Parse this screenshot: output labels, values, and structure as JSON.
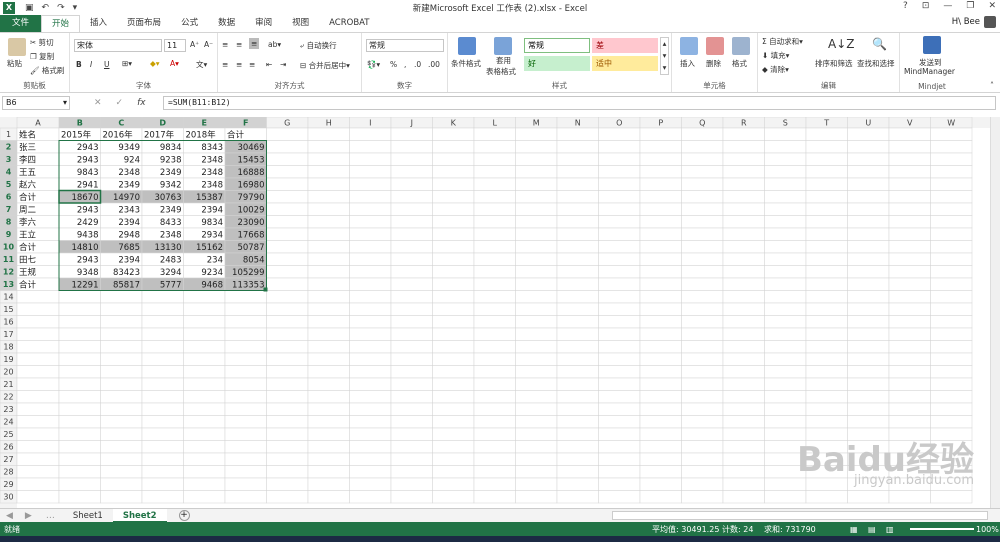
{
  "window": {
    "title": "新建Microsoft Excel 工作表 (2).xlsx - Excel",
    "user": "H\\ Bee",
    "help": "?",
    "controls": [
      "⊡",
      "—",
      "❐",
      "✕"
    ]
  },
  "ribbon_tabs": [
    "文件",
    "开始",
    "插入",
    "页面布局",
    "公式",
    "数据",
    "审阅",
    "视图",
    "ACROBAT"
  ],
  "active_tab": "开始",
  "ribbon": {
    "clipboard": {
      "label": "剪贴板",
      "paste": "粘贴",
      "cut": "剪切",
      "copy": "复制",
      "painter": "格式刷"
    },
    "font": {
      "label": "字体",
      "name": "宋体",
      "size": "11",
      "bold": "B",
      "italic": "I",
      "underline": "U"
    },
    "align": {
      "label": "对齐方式",
      "wrap": "自动换行",
      "merge": "合并后居中"
    },
    "number": {
      "label": "数字",
      "format": "常规",
      "percent": "%"
    },
    "styles": {
      "label": "样式",
      "cond": "条件格式",
      "table1": "套用",
      "table2": "表格格式",
      "cells": [
        {
          "name": "常规",
          "bg": "#ffffff",
          "border": "#7fbf7f",
          "color": "#000000"
        },
        {
          "name": "差",
          "bg": "#ffc7ce",
          "border": "#ffc7ce",
          "color": "#9c0006"
        },
        {
          "name": "好",
          "bg": "#c6efce",
          "border": "#c6efce",
          "color": "#006100"
        },
        {
          "name": "适中",
          "bg": "#ffeb9c",
          "border": "#ffeb9c",
          "color": "#9c5700"
        }
      ]
    },
    "cells": {
      "label": "单元格",
      "insert": "插入",
      "delete": "删除",
      "format": "格式"
    },
    "editing": {
      "label": "编辑",
      "autosum": "自动求和",
      "fill": "填充",
      "clear": "清除",
      "sort": "排序和筛选",
      "find": "查找和选择"
    },
    "mindjet": {
      "label": "Mindjet",
      "send1": "发送到",
      "send2": "MindManager"
    }
  },
  "formula_bar": {
    "namebox": "B6",
    "cancel": "✕",
    "confirm": "✓",
    "fx": "fx",
    "formula": "=SUM(B11:B12)"
  },
  "columns": [
    "A",
    "B",
    "C",
    "D",
    "E",
    "F",
    "G",
    "H",
    "I",
    "J",
    "K",
    "L",
    "M",
    "N",
    "O",
    "P",
    "Q",
    "R",
    "S",
    "T",
    "U",
    "V",
    "W"
  ],
  "rows": [
    [
      "姓名",
      "2015年",
      "2016年",
      "2017年",
      "2018年",
      "合计"
    ],
    [
      "张三",
      "2943",
      "9349",
      "9834",
      "8343",
      "30469"
    ],
    [
      "李四",
      "2943",
      "924",
      "9238",
      "2348",
      "15453"
    ],
    [
      "王五",
      "9843",
      "2348",
      "2349",
      "2348",
      "16888"
    ],
    [
      "赵六",
      "2941",
      "2349",
      "9342",
      "2348",
      "16980"
    ],
    [
      "合计",
      "18670",
      "14970",
      "30763",
      "15387",
      "79790"
    ],
    [
      "周二",
      "2943",
      "2343",
      "2349",
      "2394",
      "10029"
    ],
    [
      "李六",
      "2429",
      "2394",
      "8433",
      "9834",
      "23090"
    ],
    [
      "王立",
      "9438",
      "2948",
      "2348",
      "2934",
      "17668"
    ],
    [
      "合计",
      "14810",
      "7685",
      "13130",
      "15162",
      "50787"
    ],
    [
      "田七",
      "2943",
      "2394",
      "2483",
      "234",
      "8054"
    ],
    [
      "王规",
      "9348",
      "83423",
      "3294",
      "9234",
      "105299"
    ],
    [
      "合计",
      "12291",
      "85817",
      "5777",
      "9468",
      "113353"
    ]
  ],
  "row_count": 30,
  "selection": {
    "active_cell": "B6",
    "selected_columns": [
      "B",
      "C",
      "D",
      "E",
      "F"
    ],
    "selected_rows": [
      2,
      3,
      4,
      5,
      6,
      7,
      8,
      9,
      10,
      11,
      12,
      13
    ]
  },
  "shaded_cells": "#bfbfbf",
  "sheets": [
    "Sheet1",
    "Sheet2"
  ],
  "active_sheet": "Sheet2",
  "add_sheet": "+",
  "status": {
    "ready": "就绪",
    "average": "平均值: 30491.25",
    "count": "计数: 24",
    "sum": "求和: 731790",
    "zoom": "100%"
  },
  "watermark": {
    "brand": "Baidu经验",
    "url": "jingyan.baidu.com"
  },
  "colors": {
    "accent": "#217346",
    "header_selected": "#d2d2d2",
    "grid": "#d4d4d4"
  }
}
